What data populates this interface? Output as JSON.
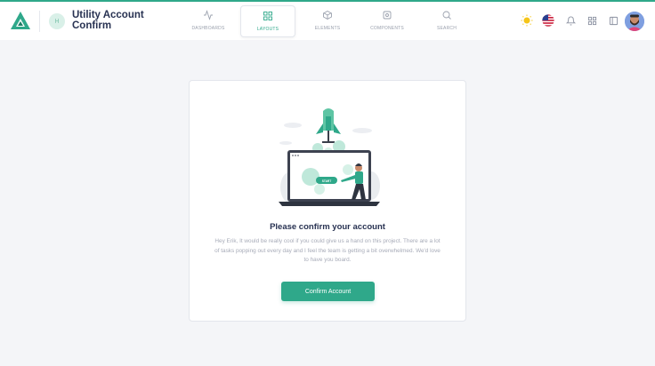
{
  "colors": {
    "accent": "#2fa88a",
    "title": "#283252",
    "muted": "#a7abb8"
  },
  "header": {
    "page_icon_text": "H",
    "page_title": "Utility Account Confirm",
    "nav": [
      {
        "label": "DASHBOARDS",
        "icon": "activity-icon"
      },
      {
        "label": "LAYOUTS",
        "icon": "grid-icon",
        "active": true
      },
      {
        "label": "ELEMENTS",
        "icon": "cube-icon"
      },
      {
        "label": "COMPONENTS",
        "icon": "cog-icon"
      },
      {
        "label": "SEARCH",
        "icon": "search-icon"
      }
    ],
    "right_icons": [
      "sun-icon",
      "us-flag-icon",
      "bell-icon",
      "apps-grid-icon",
      "sidebar-toggle-icon",
      "avatar"
    ]
  },
  "card": {
    "title": "Please confirm your account",
    "text": "Hey Erik, It would be really cool if you could give us a hand on this project. There are a lot of tasks popping out every day and I feel the team is getting a bit overwhelmed. We'd love to have you board.",
    "button_label": "Confirm Account",
    "illustration_badge": "START"
  }
}
